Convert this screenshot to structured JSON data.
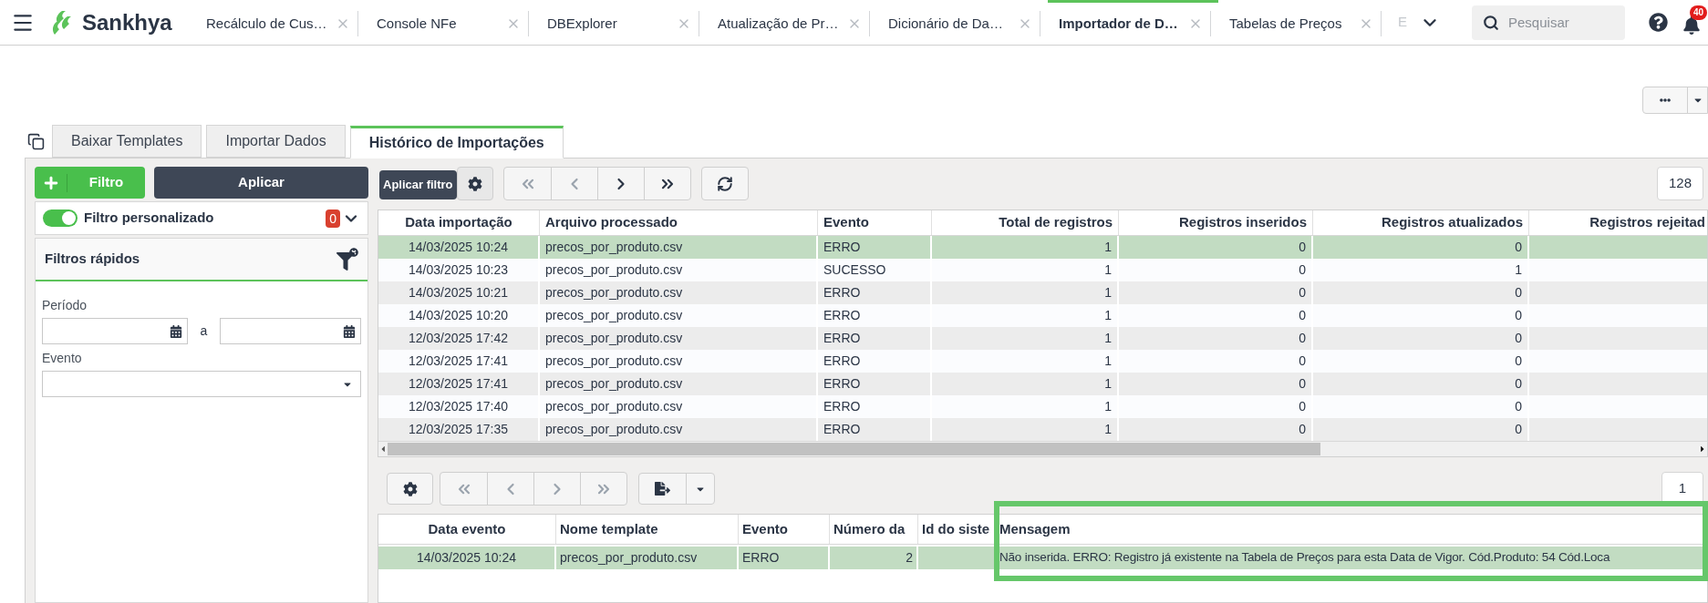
{
  "top_bar": {
    "brand": "Sankhya",
    "app_tabs": [
      {
        "label": "Recálculo de Cus…",
        "selected": false
      },
      {
        "label": "Console NFe",
        "selected": false
      },
      {
        "label": "DBExplorer",
        "selected": false
      },
      {
        "label": "Atualização de Pr…",
        "selected": false
      },
      {
        "label": "Dicionário de Da…",
        "selected": false
      },
      {
        "label": "Importador de D…",
        "selected": true
      },
      {
        "label": "Tabelas de Preços",
        "selected": false
      }
    ],
    "overflow_tab": "E",
    "search": {
      "placeholder": "Pesquisar"
    },
    "notification_count": "40"
  },
  "page_tabs": [
    {
      "label": "Baixar Templates",
      "selected": false
    },
    {
      "label": "Importar Dados",
      "selected": false
    },
    {
      "label": "Histórico de Importações",
      "selected": true
    }
  ],
  "filter_panel": {
    "add_button": "Filtro",
    "apply_button": "Aplicar",
    "tooltip": "Aplicar filtro",
    "custom_filter": {
      "label": "Filtro personalizado",
      "on": true,
      "count": "0"
    },
    "quick_filters": {
      "title": "Filtros rápidos",
      "period_label": "Período",
      "period_separator": "a",
      "event_label": "Evento"
    }
  },
  "imports_grid": {
    "record_count": "128",
    "columns": [
      "Data importação",
      "Arquivo processado",
      "Evento",
      "Total de registros",
      "Registros inseridos",
      "Registros atualizados",
      "Registros rejeitad"
    ],
    "rows": [
      {
        "selected": true,
        "date": "14/03/2025 10:24",
        "file": "precos_por_produto.csv",
        "event": "ERRO",
        "total": "1",
        "inserted": "0",
        "updated": "0"
      },
      {
        "selected": false,
        "date": "14/03/2025 10:23",
        "file": "precos_por_produto.csv",
        "event": "SUCESSO",
        "total": "1",
        "inserted": "0",
        "updated": "1"
      },
      {
        "selected": false,
        "date": "14/03/2025 10:21",
        "file": "precos_por_produto.csv",
        "event": "ERRO",
        "total": "1",
        "inserted": "0",
        "updated": "0"
      },
      {
        "selected": false,
        "date": "14/03/2025 10:20",
        "file": "precos_por_produto.csv",
        "event": "ERRO",
        "total": "1",
        "inserted": "0",
        "updated": "0"
      },
      {
        "selected": false,
        "date": "12/03/2025 17:42",
        "file": "precos_por_produto.csv",
        "event": "ERRO",
        "total": "1",
        "inserted": "0",
        "updated": "0"
      },
      {
        "selected": false,
        "date": "12/03/2025 17:41",
        "file": "precos_por_produto.csv",
        "event": "ERRO",
        "total": "1",
        "inserted": "0",
        "updated": "0"
      },
      {
        "selected": false,
        "date": "12/03/2025 17:41",
        "file": "precos_por_produto.csv",
        "event": "ERRO",
        "total": "1",
        "inserted": "0",
        "updated": "0"
      },
      {
        "selected": false,
        "date": "12/03/2025 17:40",
        "file": "precos_por_produto.csv",
        "event": "ERRO",
        "total": "1",
        "inserted": "0",
        "updated": "0"
      },
      {
        "selected": false,
        "date": "12/03/2025 17:35",
        "file": "precos_por_produto.csv",
        "event": "ERRO",
        "total": "1",
        "inserted": "0",
        "updated": "0"
      }
    ]
  },
  "events_grid": {
    "record_count": "1",
    "columns": [
      "Data evento",
      "Nome template",
      "Evento",
      "Número da",
      "Id do siste",
      "Mensagem"
    ],
    "rows": [
      {
        "selected": true,
        "date": "14/03/2025 10:24",
        "template": "precos_por_produto.csv",
        "event": "ERRO",
        "number": "2",
        "message": "Não inserida. ERRO: Registro já existente na Tabela de Preços para esta Data de Vigor. Cód.Produto: 54 Cód.Loca"
      }
    ]
  }
}
